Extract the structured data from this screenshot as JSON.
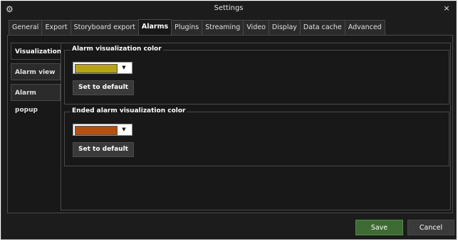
{
  "window": {
    "title": "Settings",
    "app_icon": "gears-icon",
    "close_glyph": "×"
  },
  "tabs": [
    {
      "label": "General",
      "active": false
    },
    {
      "label": "Export",
      "active": false
    },
    {
      "label": "Storyboard export",
      "active": false
    },
    {
      "label": "Alarms",
      "active": true
    },
    {
      "label": "Plugins",
      "active": false
    },
    {
      "label": "Streaming",
      "active": false
    },
    {
      "label": "Video",
      "active": false
    },
    {
      "label": "Display",
      "active": false
    },
    {
      "label": "Data cache",
      "active": false
    },
    {
      "label": "Advanced",
      "active": false
    }
  ],
  "subtabs": [
    {
      "label": "Visualization",
      "active": true
    },
    {
      "label": "Alarm view",
      "active": false
    },
    {
      "label": "Alarm popup",
      "active": false
    }
  ],
  "alarm_color": {
    "legend": "Alarm visualization color",
    "color": "#b8a21a",
    "default_label": "Set to default"
  },
  "ended_color": {
    "legend": "Ended alarm visualization color",
    "color": "#b5500f",
    "default_label": "Set to default"
  },
  "footer": {
    "save_label": "Save",
    "cancel_label": "Cancel"
  }
}
